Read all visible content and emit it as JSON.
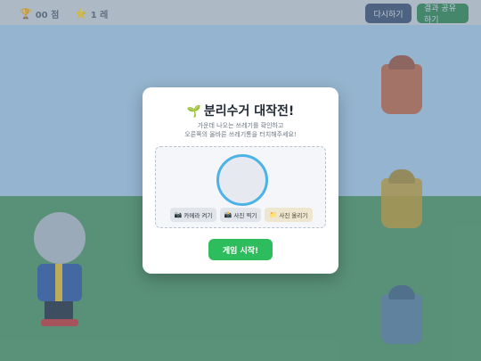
{
  "topbar": {
    "score_label": "00 점",
    "level_label": "1 레",
    "restart_label": "다시하기",
    "share_label": "결과 공유하기"
  },
  "modal": {
    "title": "분리수거 대작전!",
    "subtitle_line1": "가운데 나오는 쓰레기를 확인하고",
    "subtitle_line2": "오른쪽의 올바른 쓰레기통을 터치해주세요!",
    "camera_button": "카메라 켜기",
    "shot_button": "사진 찍기",
    "upload_button": "사진 올리기",
    "start_button": "게임 시작!"
  },
  "colors": {
    "start_green": "#2ebd5c",
    "preview_ring": "#4bb3e6"
  },
  "icons": [
    "sprout-icon",
    "camera-icon",
    "photo-icon",
    "folder-icon",
    "trophy-icon",
    "star-icon"
  ]
}
